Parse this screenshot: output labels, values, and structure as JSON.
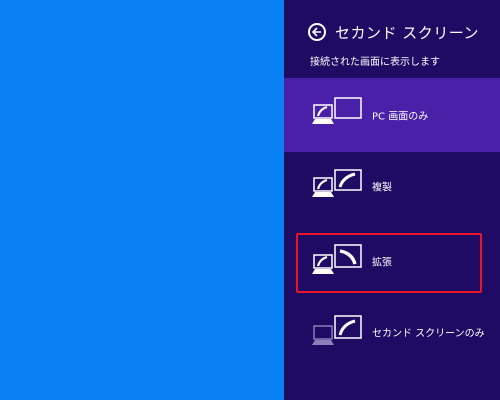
{
  "panel": {
    "title": "セカンド スクリーン",
    "subtitle": "接続された画面に表示します",
    "back_icon": "back-arrow-circle-icon",
    "background": "#1f0b64",
    "selected_background": "#4a20a8"
  },
  "desktop": {
    "background": "#0a80f5"
  },
  "options": [
    {
      "label": "PC 画面のみ",
      "icon": "pc-screen-only-icon",
      "selected": true
    },
    {
      "label": "複製",
      "icon": "duplicate-icon",
      "selected": false
    },
    {
      "label": "拡張",
      "icon": "extend-icon",
      "selected": false,
      "highlighted": true
    },
    {
      "label": "セカンド スクリーンのみ",
      "icon": "second-screen-only-icon",
      "selected": false
    }
  ],
  "highlight_color": "#e8142a"
}
